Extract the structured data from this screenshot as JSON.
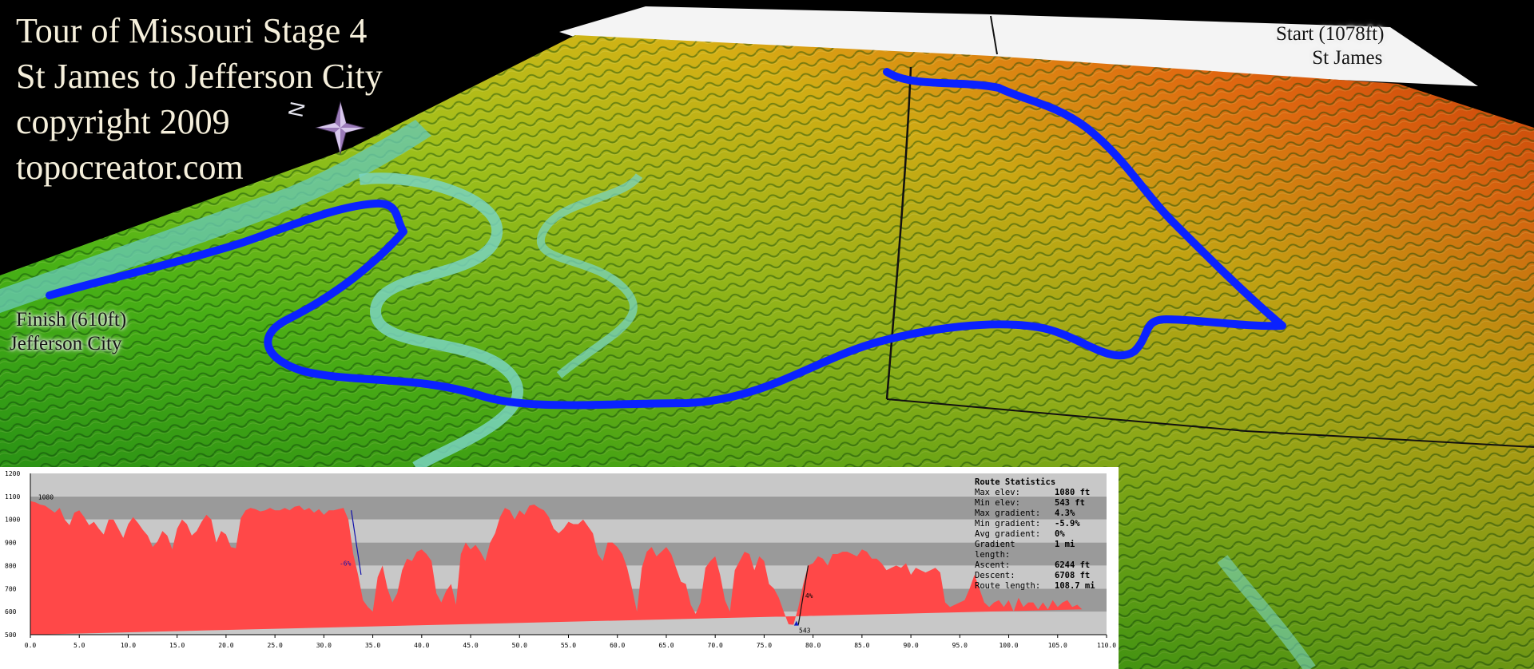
{
  "title_lines": [
    "Tour of Missouri Stage 4",
    "St James to Jefferson City",
    "copyright 2009",
    "topocreator.com"
  ],
  "compass_letter": "N",
  "labels": {
    "start": {
      "line1": "Start (1078ft)",
      "line2": "St James"
    },
    "finish": {
      "line1": "Finish (610ft)",
      "line2": "Jefferson City"
    }
  },
  "colors": {
    "route": "#0a22ff",
    "profile_fill": "#ff4848",
    "gradient_line": "#1010aa"
  },
  "chart_data": {
    "type": "area",
    "xlabel": "",
    "ylabel": "",
    "xlim": [
      0,
      110
    ],
    "ylim": [
      500,
      1200
    ],
    "x_ticks": [
      "0.0",
      "5.0",
      "10.0",
      "15.0",
      "20.0",
      "25.0",
      "30.0",
      "35.0",
      "40.0",
      "45.0",
      "50.0",
      "55.0",
      "60.0",
      "65.0",
      "70.0",
      "75.0",
      "80.0",
      "85.0",
      "90.0",
      "95.0",
      "100.0",
      "105.0",
      "110.0"
    ],
    "y_ticks": [
      "500",
      "600",
      "700",
      "800",
      "900",
      "1000",
      "1100",
      "1200"
    ],
    "x": [
      0,
      0.5,
      1,
      1.5,
      2,
      2.5,
      3,
      3.5,
      4,
      4.5,
      5,
      5.5,
      6,
      6.5,
      7,
      7.5,
      8,
      8.5,
      9,
      9.5,
      10,
      10.5,
      11,
      11.5,
      12,
      12.5,
      13,
      13.5,
      14,
      14.5,
      15,
      15.5,
      16,
      16.5,
      17,
      17.5,
      18,
      18.5,
      19,
      19.5,
      20,
      20.5,
      21,
      21.5,
      22,
      22.5,
      23,
      23.5,
      24,
      24.5,
      25,
      25.5,
      26,
      26.5,
      27,
      27.5,
      28,
      28.5,
      29,
      29.5,
      30,
      30.5,
      31,
      31.5,
      32,
      32.5,
      33,
      33.5,
      34,
      34.5,
      35,
      35.5,
      36,
      36.5,
      37,
      37.5,
      38,
      38.5,
      39,
      39.5,
      40,
      40.5,
      41,
      41.5,
      42,
      42.5,
      43,
      43.5,
      44,
      44.5,
      45,
      45.5,
      46,
      46.5,
      47,
      47.5,
      48,
      48.5,
      49,
      49.5,
      50,
      50.5,
      51,
      51.5,
      52,
      52.5,
      53,
      53.5,
      54,
      54.5,
      55,
      55.5,
      56,
      56.5,
      57,
      57.5,
      58,
      58.5,
      59,
      59.5,
      60,
      60.5,
      61,
      61.5,
      62,
      62.5,
      63,
      63.5,
      64,
      64.5,
      65,
      65.5,
      66,
      66.5,
      67,
      67.5,
      68,
      68.5,
      69,
      69.5,
      70,
      70.5,
      71,
      71.5,
      72,
      72.5,
      73,
      73.5,
      74,
      74.5,
      75,
      75.5,
      76,
      76.5,
      77,
      77.5,
      78,
      78.5,
      79,
      79.5,
      80,
      80.5,
      81,
      81.5,
      82,
      82.5,
      83,
      83.5,
      84,
      84.5,
      85,
      85.5,
      86,
      86.5,
      87,
      87.5,
      88,
      88.5,
      89,
      89.5,
      90,
      90.5,
      91,
      91.5,
      92,
      92.5,
      93,
      93.5,
      94,
      94.5,
      95,
      95.5,
      96,
      96.5,
      97,
      97.5,
      98,
      98.5,
      99,
      99.5,
      100,
      100.5,
      101,
      101.5,
      102,
      102.5,
      103,
      103.5,
      104,
      104.5,
      105,
      105.5,
      106,
      106.5,
      107,
      107.5,
      108,
      108.5
    ],
    "values": [
      1080,
      1075,
      1065,
      1060,
      1045,
      1030,
      1050,
      1000,
      975,
      1030,
      1040,
      1010,
      975,
      990,
      960,
      935,
      1000,
      1000,
      960,
      920,
      980,
      1010,
      985,
      955,
      930,
      880,
      905,
      950,
      930,
      870,
      960,
      1000,
      980,
      930,
      950,
      990,
      1020,
      1000,
      900,
      950,
      935,
      880,
      875,
      1005,
      1040,
      1050,
      1045,
      1035,
      1040,
      1050,
      1040,
      1040,
      1050,
      1040,
      1055,
      1060,
      1040,
      1050,
      1030,
      1045,
      1020,
      1040,
      1040,
      1045,
      1050,
      1000,
      850,
      760,
      650,
      620,
      600,
      750,
      800,
      700,
      640,
      680,
      780,
      830,
      820,
      860,
      870,
      850,
      820,
      680,
      640,
      690,
      720,
      630,
      850,
      900,
      870,
      890,
      860,
      820,
      900,
      940,
      1010,
      1050,
      1040,
      1000,
      1040,
      1020,
      1060,
      1065,
      1050,
      1040,
      1010,
      960,
      940,
      960,
      990,
      980,
      980,
      1000,
      970,
      940,
      850,
      820,
      900,
      900,
      880,
      850,
      790,
      700,
      600,
      790,
      860,
      880,
      840,
      860,
      880,
      850,
      790,
      730,
      720,
      630,
      590,
      640,
      790,
      820,
      840,
      760,
      650,
      600,
      780,
      820,
      860,
      850,
      780,
      840,
      820,
      720,
      700,
      660,
      600,
      545,
      543,
      620,
      720,
      800,
      810,
      840,
      830,
      800,
      850,
      850,
      860,
      860,
      850,
      840,
      870,
      860,
      830,
      830,
      810,
      780,
      790,
      800,
      790,
      810,
      760,
      790,
      780,
      770,
      780,
      790,
      770,
      640,
      620,
      630,
      640,
      650,
      700,
      760,
      700,
      640,
      620,
      640,
      650,
      620,
      650,
      600,
      660,
      620,
      640,
      640,
      610,
      640,
      610,
      650,
      620,
      640,
      650,
      620,
      630,
      610
    ],
    "annotations": {
      "max": "1080",
      "min": "543",
      "descent_grade": "-6%",
      "ascent_grade": "4%"
    },
    "stats": {
      "title": "Route Statistics",
      "rows": [
        {
          "label": "Max elev:",
          "value": "1080 ft"
        },
        {
          "label": "Min elev:",
          "value": "543 ft"
        },
        {
          "label": "Max gradient:",
          "value": "4.3%"
        },
        {
          "label": "Min gradient:",
          "value": "-5.9%"
        },
        {
          "label": "Avg gradient:",
          "value": "0%"
        },
        {
          "label": "Gradient length:",
          "value": "1 mi"
        },
        {
          "label": "Ascent:",
          "value": "6244 ft"
        },
        {
          "label": "Descent:",
          "value": "6708 ft"
        },
        {
          "label": "Route length:",
          "value": "108.7 mi"
        }
      ]
    }
  }
}
